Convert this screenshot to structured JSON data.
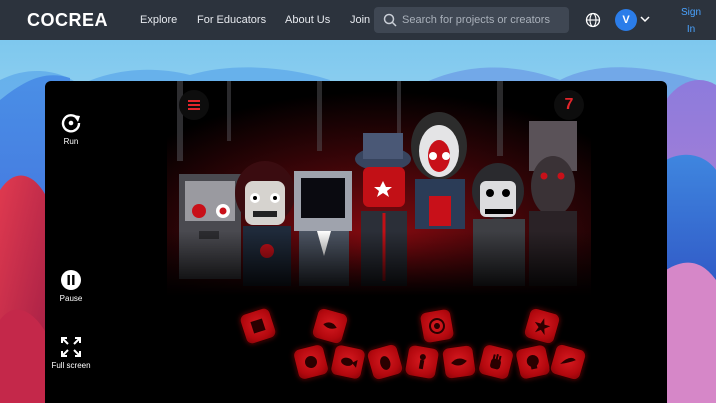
{
  "nav": {
    "logo": "COCREA",
    "links": [
      "Explore",
      "For Educators",
      "About Us",
      "Join"
    ],
    "search_placeholder": "Search for projects or creators",
    "avatar_initial": "V",
    "signin_line1": "Sign",
    "signin_line2": "In"
  },
  "player": {
    "controls": {
      "run": "Run",
      "pause": "Pause",
      "fullscreen": "Full screen"
    },
    "counter": "7",
    "sound_icons": [
      "cube-sound-icon",
      "lips-sound-icon",
      "orb-sound-icon",
      "star-sound-icon",
      "splat-sound-icon",
      "fish-sound-icon",
      "beetle-sound-icon",
      "figure-sound-icon",
      "eye-sound-icon",
      "hand-sound-icon",
      "skull-sound-icon",
      "wing-sound-icon",
      "spider-sound-icon",
      "cross-sound-icon"
    ]
  },
  "colors": {
    "nav_bg": "#2c333d",
    "accent": "#2b7de9",
    "signin": "#4aa3ff",
    "sound_red": "#c90d13"
  }
}
